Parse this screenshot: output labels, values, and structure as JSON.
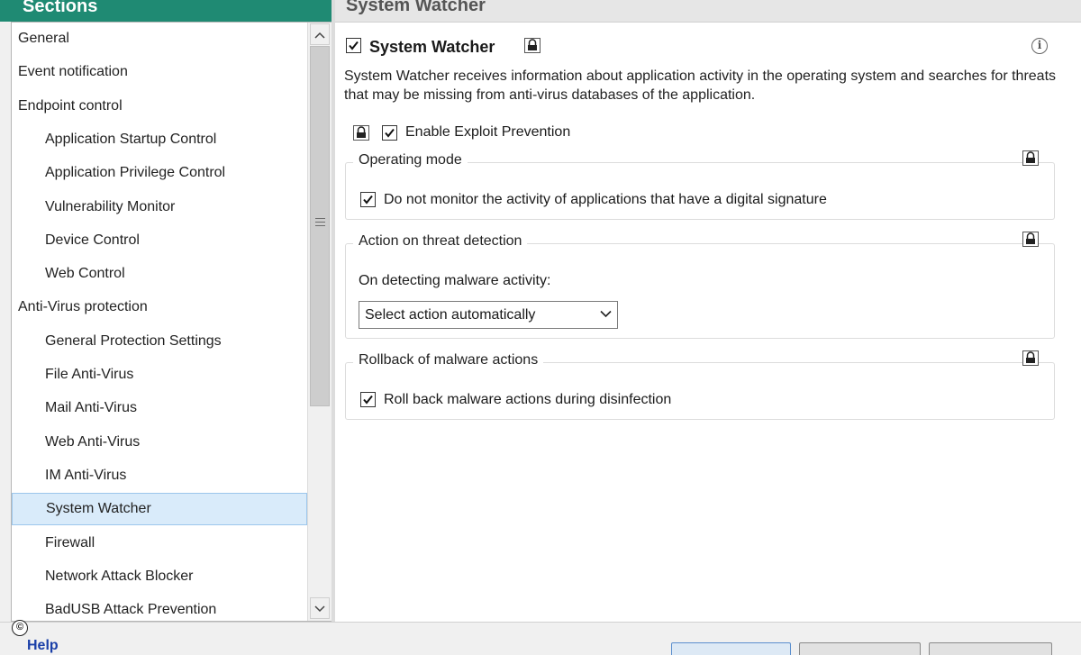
{
  "sidebar": {
    "title": "Sections",
    "items": [
      {
        "label": "General",
        "level": 0
      },
      {
        "label": "Event notification",
        "level": 0
      },
      {
        "label": "Endpoint control",
        "level": 0
      },
      {
        "label": "Application Startup Control",
        "level": 1
      },
      {
        "label": "Application Privilege Control",
        "level": 1
      },
      {
        "label": "Vulnerability Monitor",
        "level": 1
      },
      {
        "label": "Device Control",
        "level": 1
      },
      {
        "label": "Web Control",
        "level": 1
      },
      {
        "label": "Anti-Virus protection",
        "level": 0
      },
      {
        "label": "General Protection Settings",
        "level": 1
      },
      {
        "label": "File Anti-Virus",
        "level": 1
      },
      {
        "label": "Mail Anti-Virus",
        "level": 1
      },
      {
        "label": "Web Anti-Virus",
        "level": 1
      },
      {
        "label": "IM Anti-Virus",
        "level": 1
      },
      {
        "label": "System Watcher",
        "level": 1,
        "selected": true
      },
      {
        "label": "Firewall",
        "level": 1
      },
      {
        "label": "Network Attack Blocker",
        "level": 1
      },
      {
        "label": "BadUSB Attack Prevention",
        "level": 1
      }
    ]
  },
  "content": {
    "header": "System Watcher",
    "main_checkbox": {
      "label": "System Watcher",
      "checked": true
    },
    "description": "System Watcher receives information about application activity in the operating system and searches for threats that may be missing from anti-virus databases of the application.",
    "exploit_prevention": {
      "label": "Enable Exploit Prevention",
      "checked": true
    },
    "groups": {
      "operating_mode": {
        "title": "Operating mode",
        "option": {
          "label": "Do not monitor the activity of applications that have a digital signature",
          "checked": true
        }
      },
      "threat_detection": {
        "title": "Action on threat detection",
        "prompt": "On detecting malware activity:",
        "selected_action": "Select action automatically"
      },
      "rollback": {
        "title": "Rollback of malware actions",
        "option": {
          "label": "Roll back malware actions during disinfection",
          "checked": true
        }
      }
    }
  },
  "footer": {
    "help_label": "Help",
    "copyright_symbol": "©"
  },
  "colors": {
    "header_green": "#1f8a73",
    "selected_bg": "#d9ebfa",
    "link_blue": "#1a3fa8"
  }
}
